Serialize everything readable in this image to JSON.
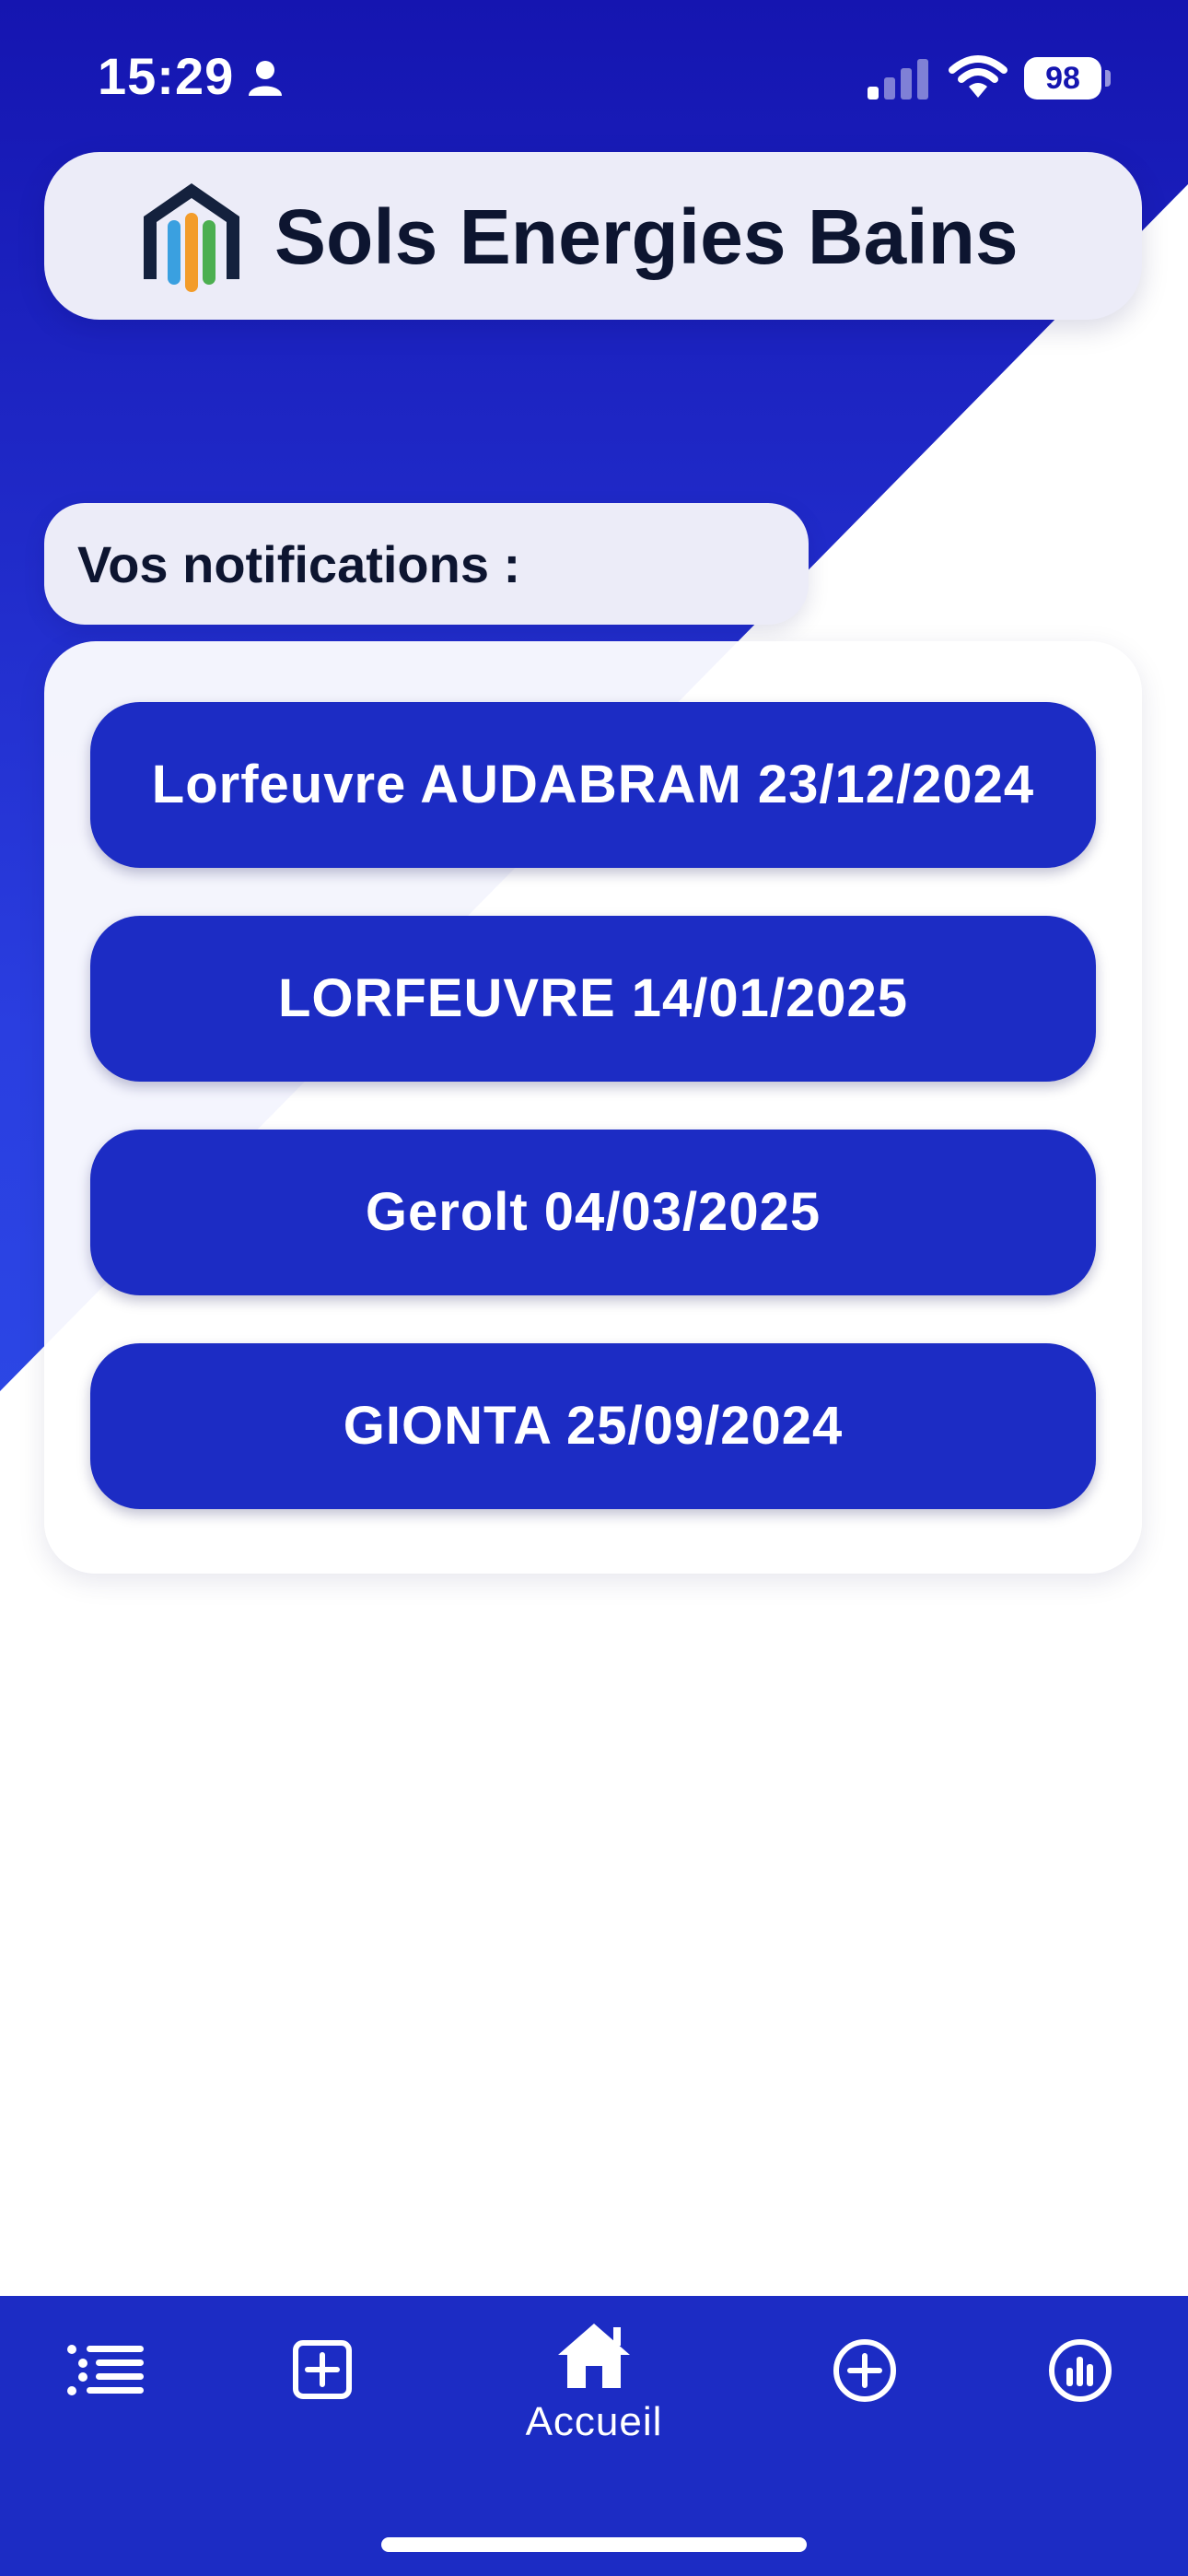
{
  "status_bar": {
    "time": "15:29",
    "battery": "98"
  },
  "header": {
    "title": "Sols Energies Bains"
  },
  "notifications": {
    "label": "Vos notifications :",
    "items": [
      {
        "label": "Lorfeuvre AUDABRAM 23/12/2024"
      },
      {
        "label": "LORFEUVRE 14/01/2025"
      },
      {
        "label": "Gerolt 04/03/2025"
      },
      {
        "label": "GIONTA 25/09/2024"
      }
    ]
  },
  "tab_bar": {
    "active_label": "Accueil",
    "tabs": [
      {
        "icon": "list-icon"
      },
      {
        "icon": "add-square-icon"
      },
      {
        "icon": "home-icon",
        "label": "Accueil"
      },
      {
        "icon": "add-circle-icon"
      },
      {
        "icon": "stats-icon"
      }
    ]
  },
  "colors": {
    "primary": "#1c2cc4",
    "background_dark": "#1515b0",
    "surface": "#ececf8"
  }
}
